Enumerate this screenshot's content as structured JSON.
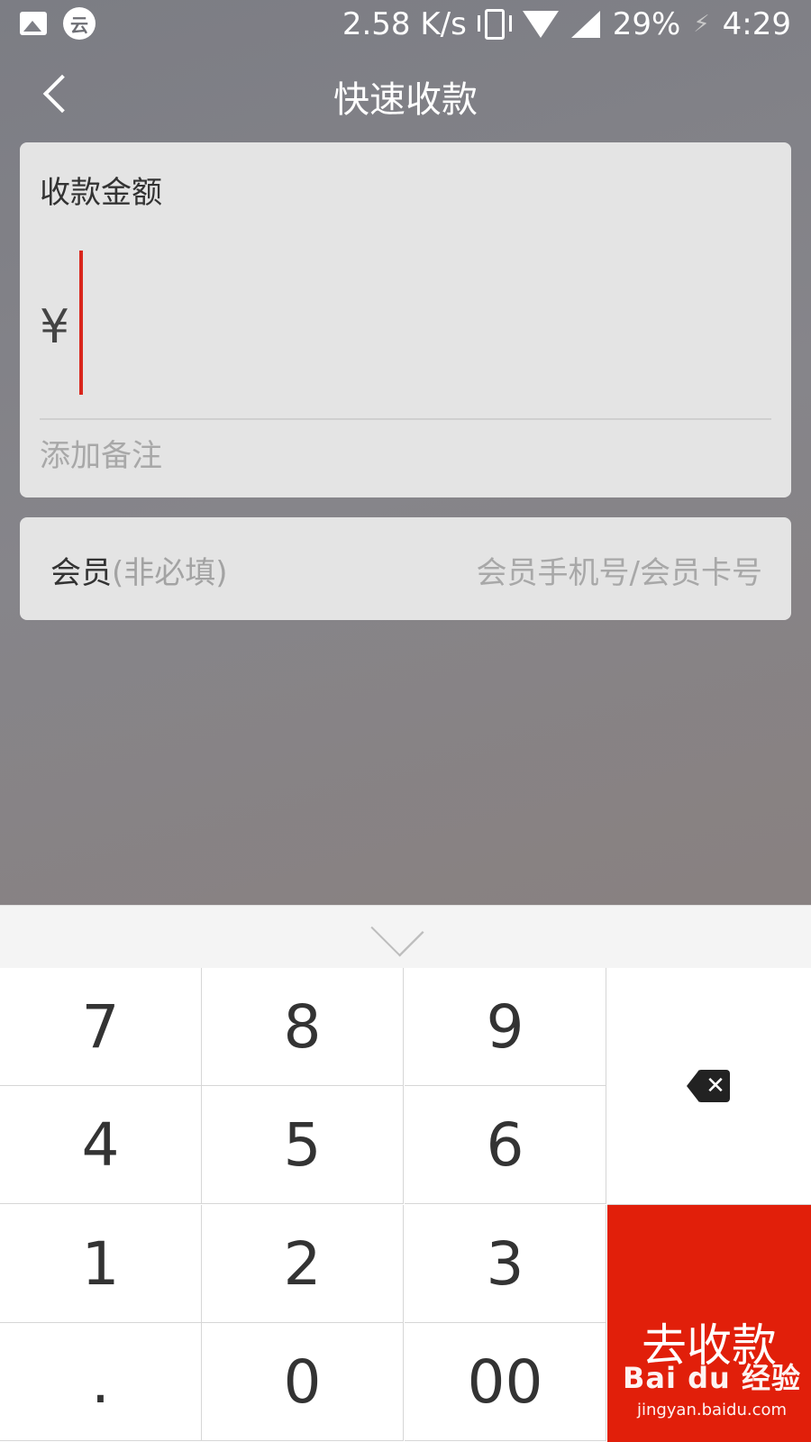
{
  "status_bar": {
    "cloud_glyph": "云",
    "network_speed": "2.58 K/s",
    "battery": "29%",
    "time": "4:29",
    "icons": [
      "image-icon",
      "cloud-icon",
      "vibrate-icon",
      "wifi-icon",
      "signal-icon",
      "charging-icon"
    ]
  },
  "header": {
    "title": "快速收款"
  },
  "amount_card": {
    "label": "收款金额",
    "currency_symbol": "¥",
    "amount_value": "",
    "remark_placeholder": "添加备注"
  },
  "member_card": {
    "label": "会员",
    "optional_note": "(非必填)",
    "input_placeholder": "会员手机号/会员卡号"
  },
  "keypad": {
    "keys": [
      "7",
      "8",
      "9",
      "4",
      "5",
      "6",
      "1",
      "2",
      "3",
      ".",
      "0",
      "00"
    ],
    "submit_label": "去收款"
  },
  "watermark": {
    "logo": "Bai du 经验",
    "url": "jingyan.baidu.com"
  },
  "colors": {
    "accent": "#e11f0a",
    "cursor": "#d9261c",
    "card_background": "#e4e4e4"
  }
}
